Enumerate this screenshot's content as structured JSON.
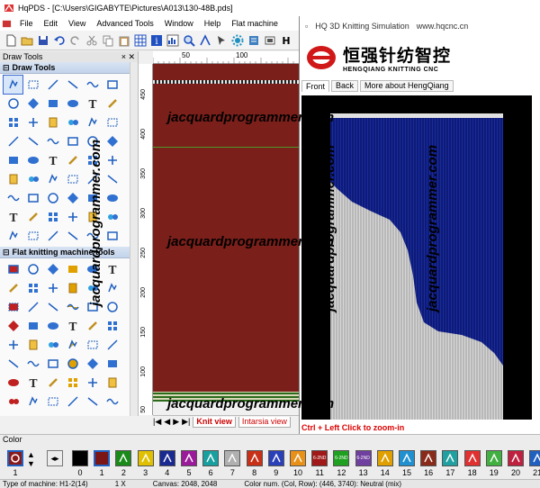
{
  "app": {
    "title": "HqPDS - [C:\\Users\\GIGABYTE\\Pictures\\A013\\130-48B.pds]",
    "menu": [
      "File",
      "Edit",
      "View",
      "Advanced Tools",
      "Window",
      "Help",
      "Flat machine"
    ]
  },
  "left_panel": {
    "header": "Draw Tools",
    "section1": "Draw Tools",
    "section2": "Flat knitting machine tools"
  },
  "rulers": {
    "top": [
      "50",
      "100"
    ],
    "left": [
      "450",
      "400",
      "350",
      "300",
      "250",
      "200",
      "150",
      "100",
      "50"
    ]
  },
  "tabs": {
    "knit": "Knit view",
    "intarsia": "Intarsia view"
  },
  "sim": {
    "title": "HQ 3D Knitting Simulation",
    "url": "www.hqcnc.cn",
    "brand_cn": "恒强针纺智控",
    "brand_en": "HENGQIANG KNITTING CNC",
    "tabs": [
      "Front",
      "Back",
      "More about HengQiang"
    ],
    "hint": "Ctrl + Left Click to zoom-in"
  },
  "color": {
    "label": "Color",
    "selected_number": "1",
    "numbers": [
      "0",
      "1",
      "2",
      "3",
      "4",
      "5",
      "6",
      "7",
      "8",
      "9",
      "10",
      "11",
      "12",
      "13",
      "14",
      "15",
      "16",
      "17",
      "18",
      "19",
      "20",
      "21"
    ],
    "swatch_colors": [
      "#000000",
      "#ffffff",
      "#1a8a1a",
      "#e0c000",
      "#1a2a90",
      "#9a1a9a",
      "#18a0a0",
      "#b0b0b0",
      "#c83018",
      "#2a40b8",
      "#e89018",
      "#a01818",
      "#20a020",
      "#7040a0",
      "#e0a000",
      "#2090d0",
      "#8a2a1a",
      "#20a0a0",
      "#e03030",
      "#40b040",
      "#c02040",
      "#2060c0"
    ],
    "swatch_labels": [
      "",
      "",
      "",
      "",
      "",
      "",
      "",
      "",
      "",
      "",
      "",
      "6-2ND",
      "6-2ND",
      "6-2ND",
      "",
      "",
      "",
      "",
      "",
      "",
      "",
      ""
    ]
  },
  "status": {
    "machine": "Type of machine: H1-2(14)",
    "zoom": "1 X",
    "canvas": "Canvas: 2048, 2048",
    "colornum": "Color num. (Col, Row): (446, 3740): Neutral (mix)"
  },
  "watermark": "jacquardprogrammer.com"
}
